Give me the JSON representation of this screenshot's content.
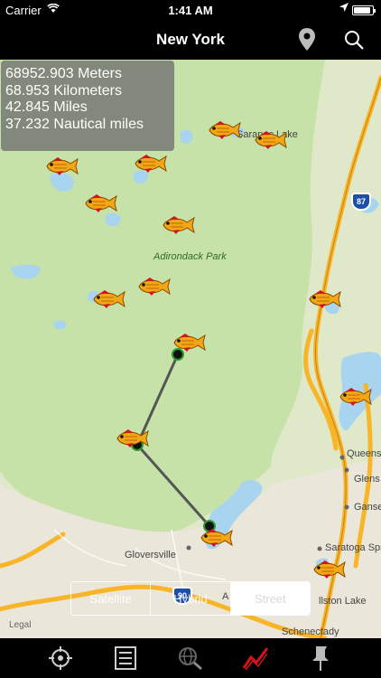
{
  "status_bar": {
    "carrier": "Carrier",
    "time": "1:41 AM",
    "battery_level": 0.92
  },
  "nav_bar": {
    "title": "New York",
    "icons": [
      "pin-icon",
      "search-icon"
    ]
  },
  "distance": {
    "meters": "68952.903 Meters",
    "kilometers": "68.953 Kilometers",
    "miles": "42.845 Miles",
    "nautical": "37.232 Nautical miles"
  },
  "map_labels": {
    "park": "Adirondack Park",
    "saranac": "Saranac Lake",
    "queensbury": "Queens",
    "glens": "Glens",
    "gansevoort": "Ganse",
    "saratoga": "Saratoga Spr",
    "gloversville": "Gloversville",
    "ballston": "llston Lake",
    "schenectady": "Schenectady",
    "amsterdam": "A",
    "i87": "87",
    "i90": "90",
    "legal": "Legal"
  },
  "map_type": {
    "options": [
      "Satellite",
      "Hybrid",
      "Street"
    ],
    "selected": "Street"
  },
  "tab_bar": {
    "items": [
      "locate-icon",
      "list-icon",
      "globe-search-icon",
      "measure-icon",
      "pushpin-icon"
    ],
    "active": "measure-icon"
  },
  "colors": {
    "land": "#dfe8c8",
    "park": "#c6e2a8",
    "water": "#a8d4ef",
    "highway": "#f7b527",
    "accent_red": "#d4141b"
  }
}
